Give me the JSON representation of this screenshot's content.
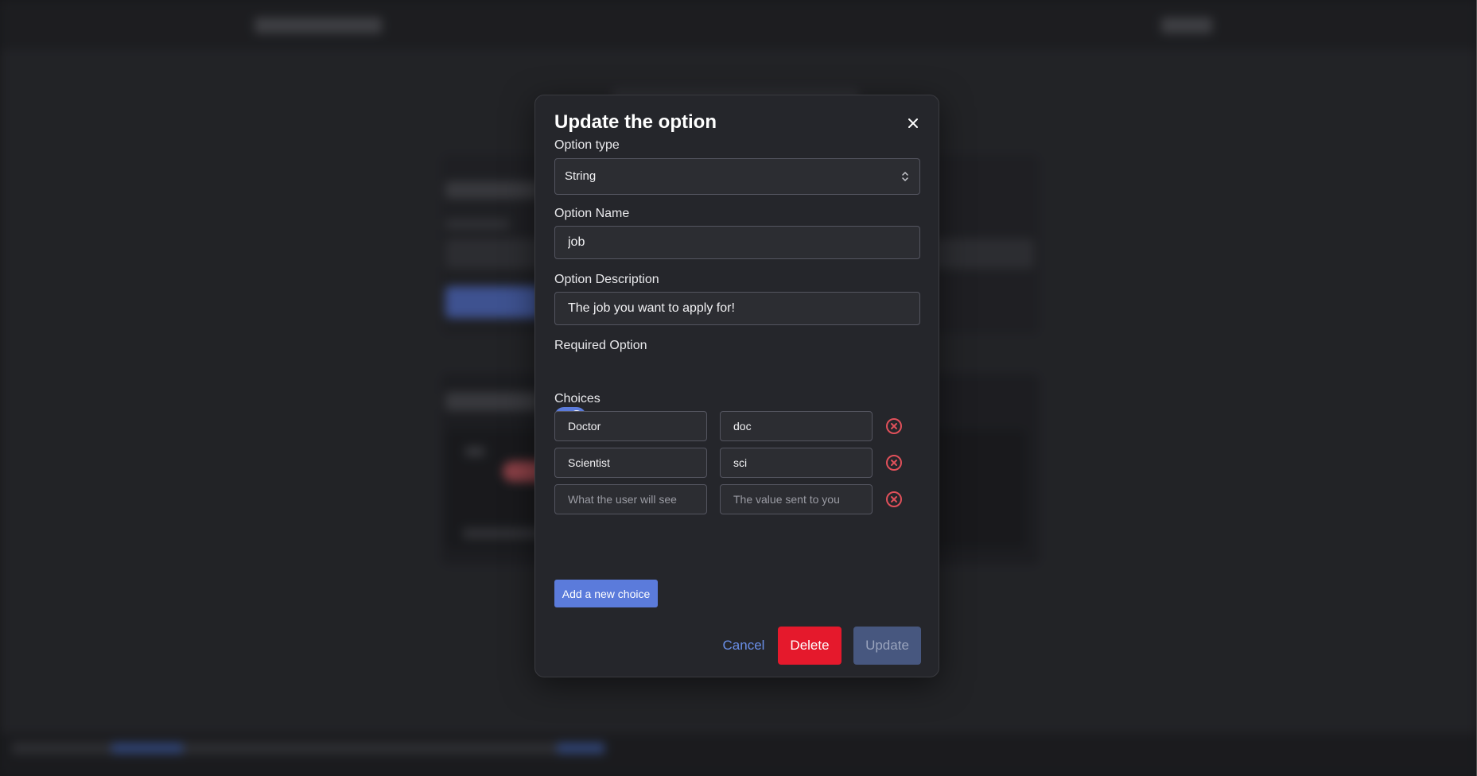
{
  "modal": {
    "title": "Update the option",
    "option_type": {
      "label": "Option type",
      "value": "String"
    },
    "option_name": {
      "label": "Option Name",
      "value": "job"
    },
    "option_description": {
      "label": "Option Description",
      "value": "The job you want to apply for!"
    },
    "required": {
      "label": "Required Option",
      "enabled": true
    },
    "choices": {
      "label": "Choices",
      "rows": [
        {
          "name": "Doctor",
          "value": "doc"
        },
        {
          "name": "Scientist",
          "value": "sci"
        },
        {
          "name": "",
          "value": ""
        }
      ],
      "name_placeholder": "What the user will see",
      "value_placeholder": "The value sent to you",
      "add_label": "Add a new choice"
    },
    "actions": {
      "cancel": "Cancel",
      "delete": "Delete",
      "update": "Update"
    }
  },
  "colors": {
    "accent": "#5b7bdb",
    "danger": "#e5192c",
    "remove_icon": "#e0505a",
    "disabled": "#47577f"
  },
  "icons": {
    "close": "close-icon",
    "select": "chevron-up-down-icon",
    "remove": "circle-x-icon"
  }
}
